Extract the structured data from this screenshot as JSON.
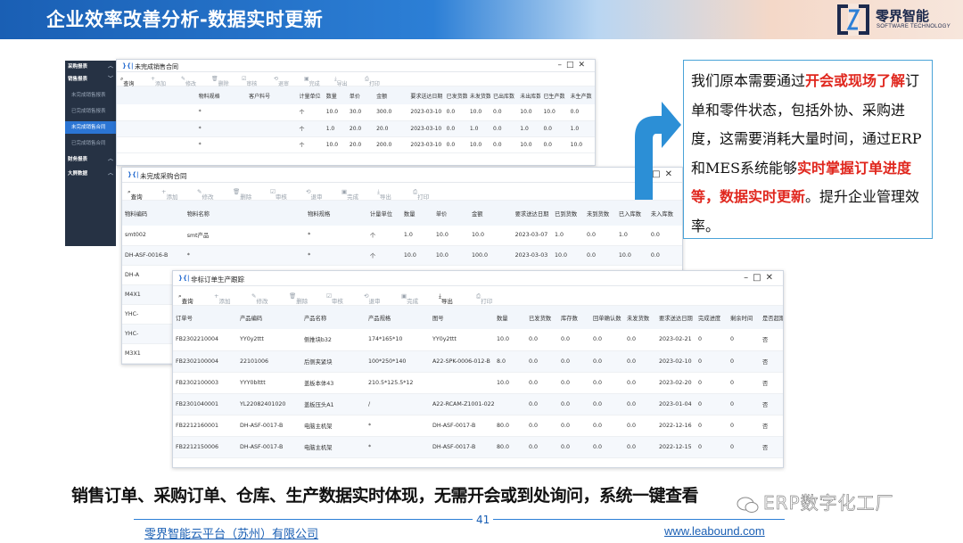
{
  "header": {
    "title": "企业效率改善分析-数据实时更新",
    "logo_cn": "零界智能",
    "logo_en": "SOFTWARE TECHNOLOGY",
    "accent": "#1a5fb4"
  },
  "sidebar": {
    "items": [
      {
        "label": "采购报表",
        "type": "group"
      },
      {
        "label": "销售报表",
        "type": "group"
      },
      {
        "label": "未完成销售报表",
        "type": "sub"
      },
      {
        "label": "已完成销售报表",
        "type": "sub"
      },
      {
        "label": "未完成销售合同",
        "type": "sub",
        "active": true
      },
      {
        "label": "已完成销售合同",
        "type": "sub"
      },
      {
        "label": "财务报表",
        "type": "group"
      },
      {
        "label": "大屏数据",
        "type": "group"
      }
    ]
  },
  "toolbar": {
    "query": "查询",
    "add": "添加",
    "edit": "修改",
    "delete": "删除",
    "review": "审核",
    "reject": "退审",
    "complete": "完成",
    "export": "导出",
    "print": "打印"
  },
  "win_sales": {
    "title": "未完成销售合同",
    "columns": [
      "",
      "物料规格",
      "客户料号",
      "计量单位",
      "数量",
      "单价",
      "金额",
      "要求送达日期",
      "已发货数",
      "未发货数",
      "已出库数",
      "未出库数",
      "已生产数",
      "未生产数"
    ],
    "rows": [
      [
        "",
        "*",
        "",
        "个",
        "10.0",
        "30.0",
        "300.0",
        "2023-03-10",
        "0.0",
        "10.0",
        "0.0",
        "10.0",
        "10.0",
        "0.0"
      ],
      [
        "",
        "*",
        "",
        "个",
        "1.0",
        "20.0",
        "20.0",
        "2023-03-10",
        "0.0",
        "1.0",
        "0.0",
        "1.0",
        "0.0",
        "1.0"
      ],
      [
        "",
        "*",
        "",
        "个",
        "10.0",
        "20.0",
        "200.0",
        "2023-03-10",
        "0.0",
        "10.0",
        "0.0",
        "10.0",
        "0.0",
        "10.0"
      ]
    ]
  },
  "win_purchase": {
    "title": "未完成采购合同",
    "columns": [
      "物料编码",
      "物料名称",
      "物料规格",
      "计量单位",
      "数量",
      "单价",
      "金额",
      "要求送达日期",
      "已到货数",
      "未到货数",
      "已入库数",
      "未入库数"
    ],
    "rows": [
      [
        "smt002",
        "smt产品",
        "*",
        "个",
        "1.0",
        "10.0",
        "10.0",
        "2023-03-07",
        "1.0",
        "0.0",
        "1.0",
        "0.0"
      ],
      [
        "DH-ASF-0016-B",
        "*",
        "*",
        "个",
        "10.0",
        "10.0",
        "100.0",
        "2023-03-03",
        "10.0",
        "0.0",
        "10.0",
        "0.0"
      ],
      [
        "DH-A",
        "",
        "",
        "",
        "",
        "",
        "",
        "",
        "",
        "",
        "",
        ""
      ],
      [
        "M4X1",
        "",
        "",
        "",
        "",
        "",
        "",
        "",
        "",
        "",
        "",
        ""
      ],
      [
        "YHC-",
        "",
        "",
        "",
        "",
        "",
        "",
        "",
        "",
        "",
        "",
        ""
      ],
      [
        "YHC-",
        "",
        "",
        "",
        "",
        "",
        "",
        "",
        "",
        "",
        "",
        ""
      ],
      [
        "M3X1",
        "",
        "",
        "",
        "",
        "",
        "",
        "",
        "",
        "",
        "",
        ""
      ]
    ]
  },
  "win_production": {
    "title": "非标订单生产跟踪",
    "columns": [
      "订单号",
      "产品编码",
      "产品名称",
      "产品规格",
      "图号",
      "数量",
      "已发货数",
      "库存数",
      "回单确认数",
      "未发货数",
      "要求送达日期",
      "完成进度",
      "剩余时间",
      "是否超期"
    ],
    "rows": [
      [
        "FB2302210004",
        "YY0y2ttt",
        "侧推块b32",
        "174*165*10",
        "YY0y2ttt",
        "10.0",
        "0.0",
        "0.0",
        "0.0",
        "0.0",
        "2023-02-21",
        "0",
        "0",
        "否"
      ],
      [
        "FB2302100004",
        "22101006",
        "后侧夹紧块",
        "100*250*140",
        "A22-SPK-0006-012-B",
        "8.0",
        "0.0",
        "0.0",
        "0.0",
        "0.0",
        "2023-02-10",
        "0",
        "0",
        "否"
      ],
      [
        "FB2302100003",
        "YYY0blttt",
        "盖板本体43",
        "210.5*125.5*12",
        "",
        "10.0",
        "0.0",
        "0.0",
        "0.0",
        "0.0",
        "2023-02-20",
        "0",
        "0",
        "否"
      ],
      [
        "FB2301040001",
        "YL22082401020",
        "盖板压头A1",
        "/",
        "A22-RCAM-Z1001-022",
        "",
        "0.0",
        "0.0",
        "0.0",
        "0.0",
        "2023-01-04",
        "0",
        "0",
        "否"
      ],
      [
        "FB2212160001",
        "DH-ASF-0017-B",
        "电脑主机架",
        "*",
        "DH-ASF-0017-B",
        "80.0",
        "0.0",
        "0.0",
        "0.0",
        "0.0",
        "2022-12-16",
        "0",
        "0",
        "否"
      ],
      [
        "FB2212150006",
        "DH-ASF-0017-B",
        "电脑主机架",
        "*",
        "DH-ASF-0017-B",
        "80.0",
        "0.0",
        "0.0",
        "0.0",
        "0.0",
        "2022-12-15",
        "0",
        "0",
        "否"
      ]
    ]
  },
  "callout": {
    "p1": "我们原本需要通过",
    "r1": "开会或现场了解",
    "p2": "订单和零件状态，包括外协、采购进度，这需要消耗大量时间，通过ERP和MES系统能够",
    "r2": "实时掌握订单进度等，数据实时更新",
    "p3": "。提升企业管理效率。",
    "border_color": "#4aa3d8",
    "highlight_color": "#e0271e"
  },
  "bottom": {
    "summary": "销售订单、采购订单、仓库、生产数据实时体现，无需开会或到处询问，系统一键查看",
    "company": "零界智能云平台（苏州）有限公司",
    "page": "41",
    "url": "www.leabound.com",
    "watermark": "ERP数字化工厂"
  }
}
